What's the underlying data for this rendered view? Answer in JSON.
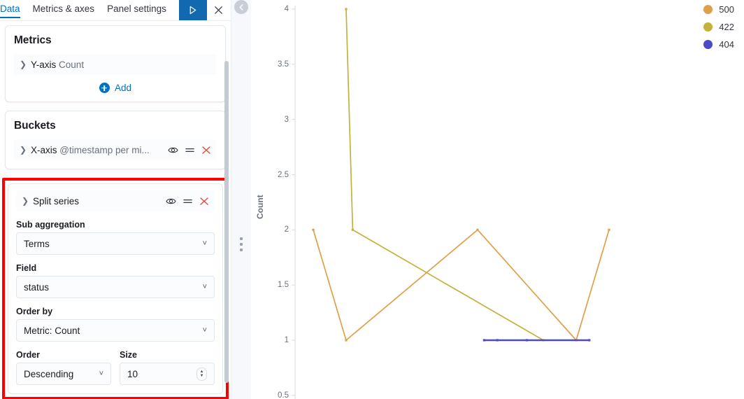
{
  "editor": {
    "tabs": [
      {
        "label": "Data",
        "active": true
      },
      {
        "label": "Metrics & axes",
        "active": false
      },
      {
        "label": "Panel settings",
        "active": false
      }
    ],
    "apply_icon": "play-icon",
    "close_icon": "close-icon",
    "metrics": {
      "title": "Metrics",
      "rows": [
        {
          "prefix": "Y-axis",
          "value": "Count"
        }
      ],
      "add_label": "Add"
    },
    "buckets": {
      "title": "Buckets",
      "x_axis": {
        "prefix": "X-axis",
        "value": "@timestamp per mi..."
      },
      "split_series": {
        "title": "Split series",
        "fields": [
          {
            "label": "Sub aggregation",
            "value": "Terms"
          },
          {
            "label": "Field",
            "value": "status"
          },
          {
            "label": "Order by",
            "value": "Metric: Count"
          }
        ],
        "order": {
          "label": "Order",
          "value": "Descending"
        },
        "size": {
          "label": "Size",
          "value": "10"
        }
      }
    },
    "row_icons": {
      "eye": "eye-icon",
      "drag": "drag-handle-icon",
      "remove": "remove-icon"
    },
    "highlight_color": "#fe0000"
  },
  "gutter": {
    "collapse_icon": "chevron-left-icon",
    "resize_grip": "resize-grip-icon"
  },
  "chart_data": {
    "type": "line",
    "title": "",
    "xlabel": "",
    "ylabel": "Count",
    "ylim": [
      0.5,
      4
    ],
    "yticks": [
      4,
      3.5,
      3,
      2.5,
      2,
      1.5,
      1,
      0.5
    ],
    "ytick_labels": [
      "4",
      "3.5",
      "3",
      "2.5",
      "2",
      "1.5",
      "1",
      "0.5"
    ],
    "grid": false,
    "legend_position": "top-right",
    "x": [
      1,
      2,
      3,
      4,
      5,
      6,
      7,
      8,
      9,
      10
    ],
    "series": [
      {
        "name": "500",
        "color": "#e0a04a",
        "x": [
          1,
          2,
          6,
          9,
          10
        ],
        "values": [
          2,
          1,
          2,
          1,
          2
        ]
      },
      {
        "name": "422",
        "color": "#c3b23c",
        "x": [
          2,
          2.2,
          8
        ],
        "values": [
          4,
          2,
          1
        ]
      },
      {
        "name": "404",
        "color": "#4a4ac8",
        "x": [
          6.2,
          6.6,
          7.5,
          9.4
        ],
        "values": [
          1,
          1,
          1,
          1
        ]
      }
    ]
  }
}
